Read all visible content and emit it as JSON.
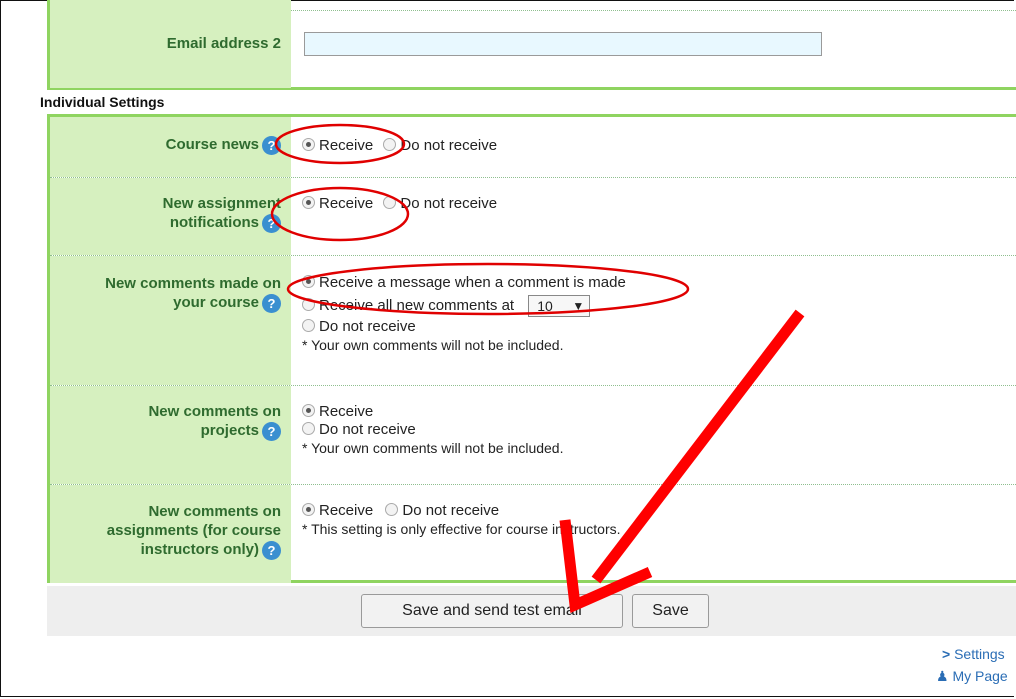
{
  "email": {
    "label": "Email address 2",
    "value": ""
  },
  "section_title": "Individual Settings",
  "settings": {
    "course_news": {
      "label": "Course news",
      "opt1": "Receive",
      "opt2": "Do not receive"
    },
    "new_assignment": {
      "label_line1": "New assignment",
      "label_line2": "notifications",
      "opt1": "Receive",
      "opt2": "Do not receive"
    },
    "new_comments_course": {
      "label_line1": "New comments made on",
      "label_line2": "your course",
      "opt1": "Receive a message when a comment is made",
      "opt2": "Receive all new comments at",
      "select_value": "10",
      "opt3": "Do not receive",
      "note": "* Your own comments will not be included."
    },
    "new_comments_projects": {
      "label_line1": "New comments on",
      "label_line2": "projects",
      "opt1": "Receive",
      "opt2": "Do not receive",
      "note": "* Your own comments will not be included."
    },
    "new_comments_assignments": {
      "label_line1": "New comments on",
      "label_line2": "assignments (for course",
      "label_line3": "instructors only)",
      "opt1": "Receive",
      "opt2": "Do not receive",
      "note": "* This setting is only effective for course instructors."
    }
  },
  "buttons": {
    "save_test": "Save and send test email",
    "save": "Save"
  },
  "footer": {
    "settings_link": "Settings",
    "mypage_link": "My Page"
  },
  "colors": {
    "label_bg": "#d6f0bf",
    "border": "#8fd460",
    "label_text": "#2f6b2f",
    "annotation": "#e00000"
  }
}
